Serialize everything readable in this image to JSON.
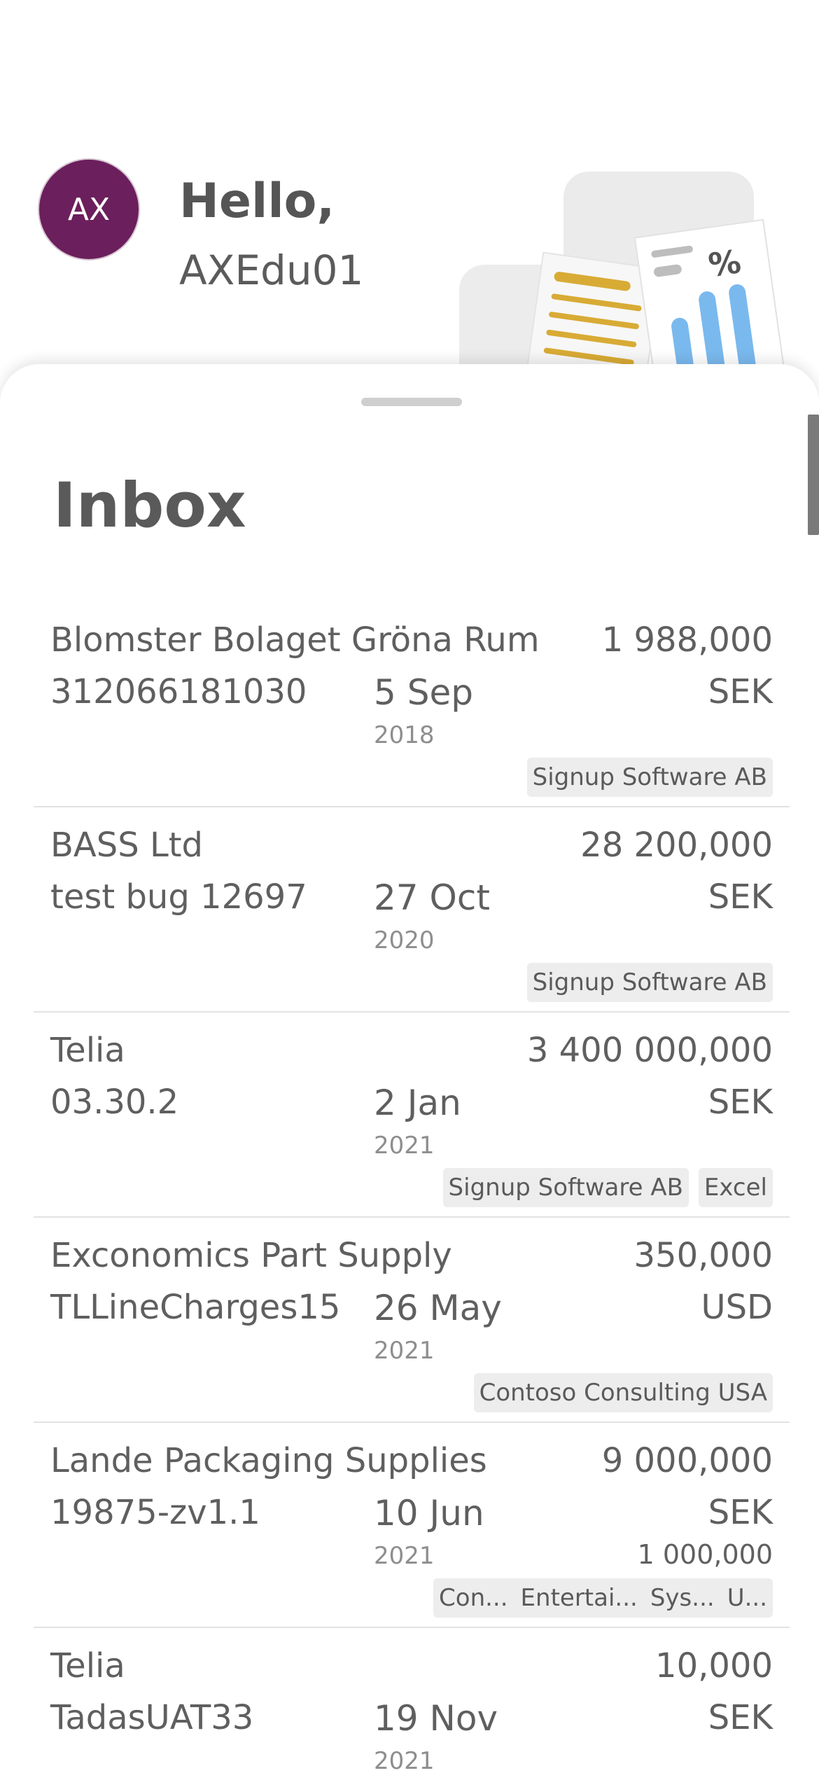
{
  "user": {
    "initials": "AX",
    "greeting": "Hello,",
    "name": "AXEdu01"
  },
  "inbox": {
    "title": "Inbox",
    "items": [
      {
        "name": "Blomster Bolaget Gröna Rum",
        "amount": "1 988,000",
        "ref": "312066181030",
        "date": "5 Sep",
        "year": "2018",
        "currency": "SEK",
        "tags": [
          "Signup Software AB"
        ]
      },
      {
        "name": "BASS Ltd",
        "amount": "28 200,000",
        "ref": "test bug 12697",
        "date": "27 Oct",
        "year": "2020",
        "currency": "SEK",
        "tags": [
          "Signup Software AB"
        ]
      },
      {
        "name": "Telia",
        "amount": "3 400 000,000",
        "ref": "03.30.2",
        "date": "2 Jan",
        "year": "2021",
        "currency": "SEK",
        "tags": [
          "Signup Software AB",
          "Excel"
        ]
      },
      {
        "name": "Exconomics Part Supply",
        "amount": "350,000",
        "ref": "TLLineCharges15",
        "date": "26 May",
        "year": "2021",
        "currency": "USD",
        "tags": [
          "Contoso Consulting USA"
        ]
      },
      {
        "name": "Lande Packaging Supplies",
        "amount": "9 000,000",
        "ref": "19875-zv1.1",
        "date": "10 Jun",
        "year": "2021",
        "currency": "SEK",
        "secondary_amount": "1 000,000",
        "tag_group": [
          "Con...",
          "Entertai...",
          "Sys...",
          "U..."
        ]
      },
      {
        "name": "Telia",
        "amount": "10,000",
        "ref": "TadasUAT33",
        "date": "19 Nov",
        "year": "2021",
        "currency": "SEK"
      }
    ]
  }
}
